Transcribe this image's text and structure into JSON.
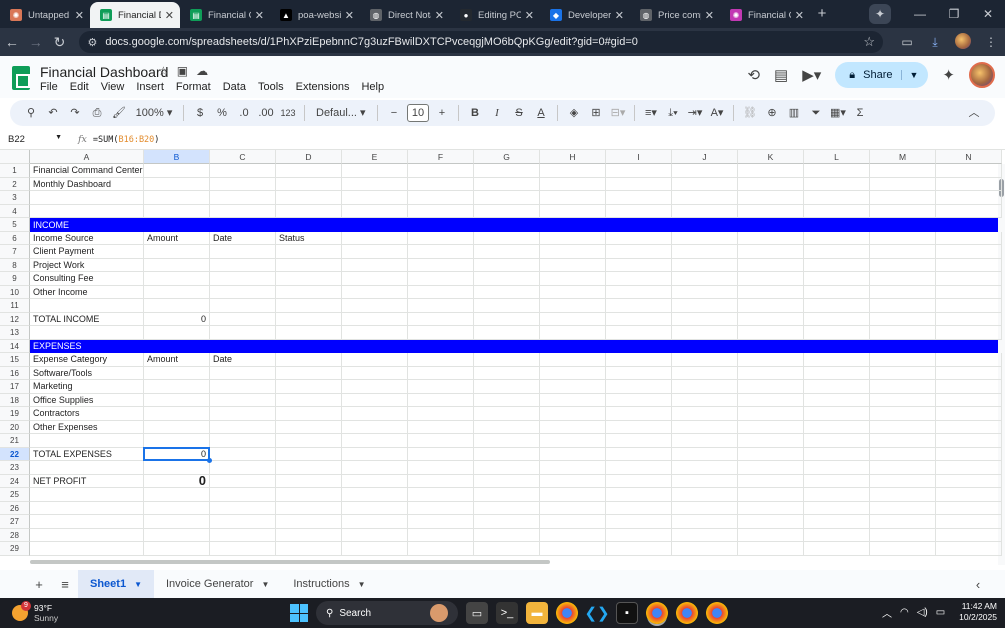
{
  "browser": {
    "tabs": [
      {
        "title": "Untapped mark",
        "icon": "claude-icon",
        "color": "#d97757",
        "active": false
      },
      {
        "title": "Financial Dash",
        "icon": "sheets-icon",
        "color": "#0f9d58",
        "active": true
      },
      {
        "title": "Financial Co",
        "icon": "sheets-icon",
        "color": "#0f9d58",
        "active": false
      },
      {
        "title": "poa-website",
        "icon": "vercel-icon",
        "color": "#000000",
        "active": false
      },
      {
        "title": "Direct Notar",
        "icon": "globe-icon",
        "color": "#5f6368",
        "active": false
      },
      {
        "title": "Editing POA",
        "icon": "github-icon",
        "color": "#24292f",
        "active": false
      },
      {
        "title": "Developer D",
        "icon": "docs-icon",
        "color": "#1a73e8",
        "active": false
      },
      {
        "title": "Price compa",
        "icon": "globe-icon",
        "color": "#5f6368",
        "active": false
      },
      {
        "title": "Financial Co",
        "icon": "claude-icon",
        "color": "#c239b3",
        "active": false
      }
    ],
    "url": "docs.google.com/spreadsheets/d/1PhXPziEpebnnC7g3uzFBwilDXTCPvceqgjMO6bQpKGg/edit?gid=0#gid=0"
  },
  "doc": {
    "title": "Financial Dashboard",
    "menu": [
      "File",
      "Edit",
      "View",
      "Insert",
      "Format",
      "Data",
      "Tools",
      "Extensions",
      "Help"
    ],
    "share_label": "Share"
  },
  "toolbar": {
    "zoom": "100%",
    "currency": "$",
    "percent": "%",
    "dec_dec": ".0",
    "dec_inc": ".00",
    "number_format": "123",
    "font": "Defaul...",
    "font_size": "10",
    "bold": "B",
    "italic": "I",
    "strike": "S",
    "text_color": "A",
    "sum": "Σ"
  },
  "formula_bar": {
    "cell_ref": "B22",
    "formula_prefix": "=SUM(",
    "formula_range": "B16:B20",
    "formula_suffix": ")"
  },
  "grid": {
    "columns": [
      "A",
      "B",
      "C",
      "D",
      "E",
      "F",
      "G",
      "H",
      "I",
      "J",
      "K",
      "L",
      "M",
      "N"
    ],
    "selected_column": "B",
    "selected_row": "22",
    "rows": [
      {
        "n": "1",
        "a": "Financial Command Center"
      },
      {
        "n": "2",
        "a": "Monthly Dashboard"
      },
      {
        "n": "3"
      },
      {
        "n": "4"
      },
      {
        "n": "5",
        "band": "INCOME"
      },
      {
        "n": "6",
        "a": "Income Source",
        "b": "Amount",
        "c": "Date",
        "d": "Status"
      },
      {
        "n": "7",
        "a": "Client Payment"
      },
      {
        "n": "8",
        "a": "Project Work"
      },
      {
        "n": "9",
        "a": "Consulting Fee"
      },
      {
        "n": "10",
        "a": "Other Income"
      },
      {
        "n": "11"
      },
      {
        "n": "12",
        "a": "TOTAL INCOME",
        "b_num": "0"
      },
      {
        "n": "13"
      },
      {
        "n": "14",
        "band": "EXPENSES"
      },
      {
        "n": "15",
        "a": "Expense Category",
        "b": "Amount",
        "c": "Date"
      },
      {
        "n": "16",
        "a": "Software/Tools"
      },
      {
        "n": "17",
        "a": "Marketing"
      },
      {
        "n": "18",
        "a": "Office Supplies"
      },
      {
        "n": "19",
        "a": "Contractors"
      },
      {
        "n": "20",
        "a": "Other Expenses"
      },
      {
        "n": "21"
      },
      {
        "n": "22",
        "a": "TOTAL EXPENSES",
        "b_num": "0"
      },
      {
        "n": "23"
      },
      {
        "n": "24",
        "a": "NET PROFIT",
        "b_big": "0"
      },
      {
        "n": "25"
      },
      {
        "n": "26"
      },
      {
        "n": "27"
      },
      {
        "n": "28"
      },
      {
        "n": "29"
      }
    ],
    "band_color": "#0000ff"
  },
  "sheets": [
    {
      "name": "Sheet1",
      "active": true
    },
    {
      "name": "Invoice Generator",
      "active": false
    },
    {
      "name": "Instructions",
      "active": false
    }
  ],
  "taskbar": {
    "weather_temp": "93°F",
    "weather_desc": "Sunny",
    "weather_badge": "9",
    "search_label": "Search",
    "time": "11:42 AM",
    "date": "10/2/2025"
  }
}
